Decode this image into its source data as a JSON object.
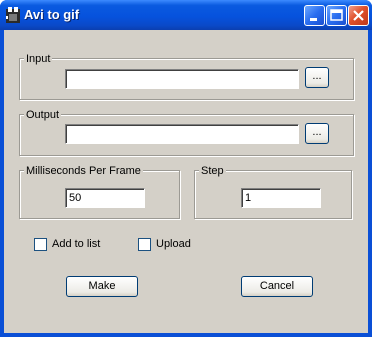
{
  "window": {
    "title": "Avi to gif"
  },
  "input_group": {
    "label": "Input",
    "value": "",
    "browse_label": "..."
  },
  "output_group": {
    "label": "Output",
    "value": "",
    "browse_label": "..."
  },
  "ms_group": {
    "label": "Milliseconds Per Frame",
    "value": "50"
  },
  "step_group": {
    "label": "Step",
    "value": "1"
  },
  "options": {
    "add_to_list_label": "Add to list",
    "upload_label": "Upload"
  },
  "actions": {
    "make_label": "Make",
    "cancel_label": "Cancel"
  },
  "icons": {
    "app": "film-projector-icon",
    "minimize": "minimize-icon",
    "maximize": "maximize-icon",
    "close": "close-icon"
  },
  "colors": {
    "titlebar": "#0652dd",
    "dialog_background": "#d4d0c8",
    "close_button": "#e0502a"
  }
}
